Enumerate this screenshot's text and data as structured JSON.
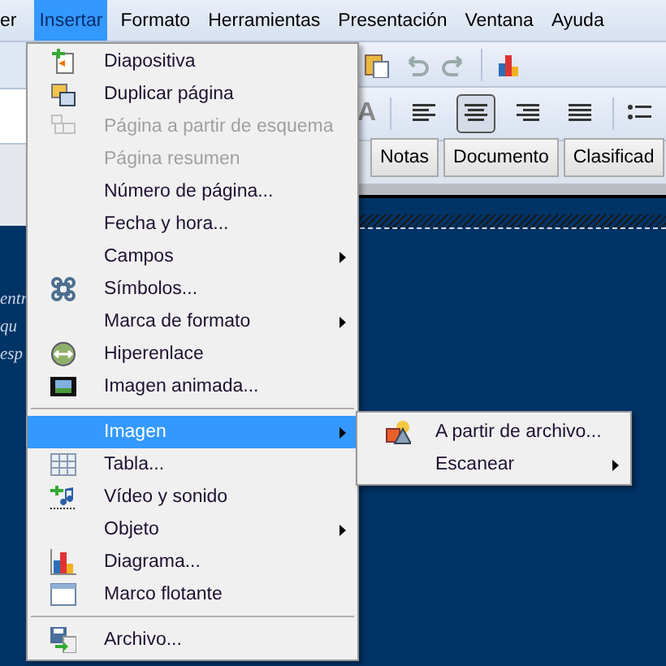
{
  "menubar": [
    {
      "label": "er",
      "selected": false
    },
    {
      "label": "Insertar",
      "selected": true
    },
    {
      "label": "Formato",
      "selected": false
    },
    {
      "label": "Herramientas",
      "selected": false
    },
    {
      "label": "Presentación",
      "selected": false
    },
    {
      "label": "Ventana",
      "selected": false
    },
    {
      "label": "Ayuda",
      "selected": false
    }
  ],
  "format_toolbar": {
    "cut_label": "A",
    "align_buttons": [
      {
        "selected": false
      },
      {
        "selected": true
      },
      {
        "selected": false
      },
      {
        "selected": false
      }
    ]
  },
  "view_tabs": [
    {
      "label": "Notas"
    },
    {
      "label": "Documento"
    },
    {
      "label": "Clasificad"
    }
  ],
  "slide_fragments": [
    "entr",
    "qu",
    "esp"
  ],
  "menu": [
    {
      "kind": "item",
      "label": "Diapositiva",
      "disabled": false,
      "selected": false,
      "submenu": false
    },
    {
      "kind": "item",
      "label": "Duplicar página",
      "disabled": false,
      "selected": false,
      "submenu": false
    },
    {
      "kind": "item",
      "label": "Página a partir de esquema",
      "disabled": true,
      "selected": false,
      "submenu": false
    },
    {
      "kind": "item",
      "label": "Página resumen",
      "disabled": true,
      "selected": false,
      "submenu": false
    },
    {
      "kind": "item",
      "label": "Número de página...",
      "disabled": false,
      "selected": false,
      "submenu": false
    },
    {
      "kind": "item",
      "label": "Fecha y hora...",
      "disabled": false,
      "selected": false,
      "submenu": false
    },
    {
      "kind": "item",
      "label": "Campos",
      "disabled": false,
      "selected": false,
      "submenu": true
    },
    {
      "kind": "item",
      "label": "Símbolos...",
      "disabled": false,
      "selected": false,
      "submenu": false
    },
    {
      "kind": "item",
      "label": "Marca de formato",
      "disabled": false,
      "selected": false,
      "submenu": true
    },
    {
      "kind": "item",
      "label": "Hiperenlace",
      "disabled": false,
      "selected": false,
      "submenu": false
    },
    {
      "kind": "item",
      "label": "Imagen animada...",
      "disabled": false,
      "selected": false,
      "submenu": false
    },
    {
      "kind": "separator"
    },
    {
      "kind": "item",
      "label": "Imagen",
      "disabled": false,
      "selected": true,
      "submenu": true
    },
    {
      "kind": "item",
      "label": "Tabla...",
      "disabled": false,
      "selected": false,
      "submenu": false
    },
    {
      "kind": "item",
      "label": "Vídeo y sonido",
      "disabled": false,
      "selected": false,
      "submenu": false
    },
    {
      "kind": "item",
      "label": "Objeto",
      "disabled": false,
      "selected": false,
      "submenu": true
    },
    {
      "kind": "item",
      "label": "Diagrama...",
      "disabled": false,
      "selected": false,
      "submenu": false
    },
    {
      "kind": "item",
      "label": "Marco flotante",
      "disabled": false,
      "selected": false,
      "submenu": false
    },
    {
      "kind": "separator"
    },
    {
      "kind": "item",
      "label": "Archivo...",
      "disabled": false,
      "selected": false,
      "submenu": false
    }
  ],
  "submenu": [
    {
      "label": "A partir de archivo...",
      "submenu": false
    },
    {
      "label": "Escanear",
      "submenu": true
    }
  ]
}
